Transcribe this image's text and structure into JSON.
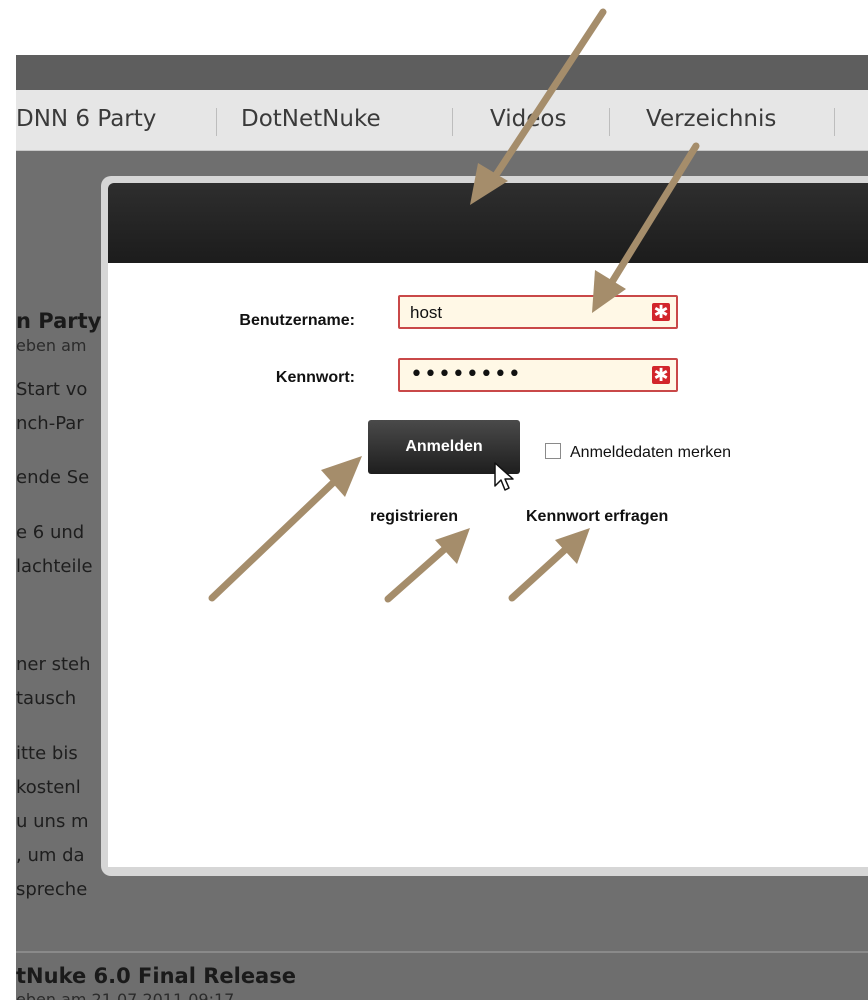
{
  "nav": {
    "items": [
      "DNN 6 Party",
      "DotNetNuke",
      "Videos",
      "Verzeichnis"
    ]
  },
  "article1": {
    "title": "n Party",
    "meta": "eben am",
    "lines": [
      "Start vo",
      "nch-Par",
      "ende Se",
      "e 6 und",
      "lachteile",
      "ner steh",
      "tausch",
      "itte bis",
      "kostenl",
      "u uns m",
      ", um da",
      "spreche"
    ]
  },
  "article2": {
    "title": "tNuke 6.0 Final Release",
    "meta": "eben am 21.07.2011 09:17"
  },
  "login": {
    "username_label": "Benutzername:",
    "username_value": "host",
    "password_label": "Kennwort:",
    "password_value": "••••••••",
    "required_mark": "✱",
    "submit_label": "Anmelden",
    "remember_label": "Anmeldedaten merken",
    "register_link": "registrieren",
    "forgot_link": "Kennwort erfragen"
  },
  "colors": {
    "annotation_arrow": "#a58d6b",
    "required": "#d2252b"
  },
  "icons": {
    "required": "required-field-icon",
    "cursor": "mouse-pointer-icon",
    "arrow": "annotation-arrow-icon"
  }
}
